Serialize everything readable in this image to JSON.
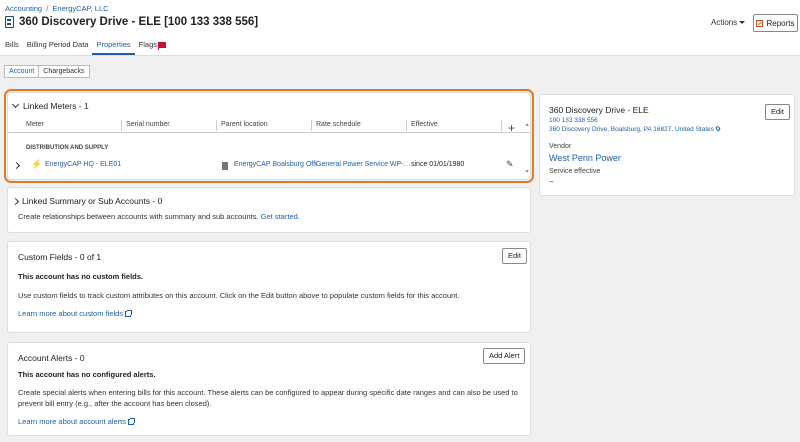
{
  "breadcrumb": {
    "parent": "Accounting",
    "separator": "/",
    "current": "EnergyCAP, LLC"
  },
  "header": {
    "title": "360 Discovery Drive - ELE [100 133 338 556]",
    "actions_label": "Actions",
    "reports_label": "Reports"
  },
  "tabs": [
    {
      "label": "Bills"
    },
    {
      "label": "Billing Period Data"
    },
    {
      "label": "Properties"
    },
    {
      "label": "Flags"
    }
  ],
  "subtabs": [
    {
      "label": "Account"
    },
    {
      "label": "Chargebacks"
    }
  ],
  "linked_meters": {
    "title": "Linked Meters - 1",
    "columns": [
      "Meter",
      "Serial number",
      "Parent location",
      "Rate schedule",
      "Effective"
    ],
    "group_label": "DISTRIBUTION AND SUPPLY",
    "row": {
      "meter": "EnergyCAP HQ - ELE01",
      "serial": "",
      "parent_location": "EnergyCAP Boalsburg Offi…",
      "rate_schedule": "General Power Service WP-…",
      "effective": "since 01/01/1980"
    }
  },
  "linked_summary": {
    "title": "Linked Summary or Sub Accounts - 0",
    "description": "Create relationships between accounts with summary and sub accounts.",
    "link": "Get started."
  },
  "custom_fields": {
    "title": "Custom Fields - 0 of 1",
    "edit_label": "Edit",
    "empty_text": "This account has no custom fields.",
    "description": "Use custom fields to track custom attributes on this account. Click on the Edit button above to populate custom fields for this account.",
    "learn_more": "Learn more about custom fields"
  },
  "account_alerts": {
    "title": "Account Alerts - 0",
    "add_label": "Add Alert",
    "empty_text": "This account has no configured alerts.",
    "description": "Create special alerts when entering bills for this account. These alerts can be configured to appear during specific date ranges and can also be used to prevent bill entry (e.g., after the account has been closed).",
    "learn_more": "Learn more about account alerts"
  },
  "account_card": {
    "name": "360 Discovery Drive - ELE",
    "edit_label": "Edit",
    "code": "100 133 338 556",
    "address": "360 Discovery Drive, Boalsburg, PA 16827, United States",
    "vendor_label": "Vendor",
    "vendor": "West Penn Power",
    "service_label": "Service effective",
    "service_value": "–"
  },
  "colors": {
    "link": "#1f5fa8",
    "highlight": "#e07a28",
    "flag": "#c8102e",
    "bolt": "#e8a317"
  }
}
